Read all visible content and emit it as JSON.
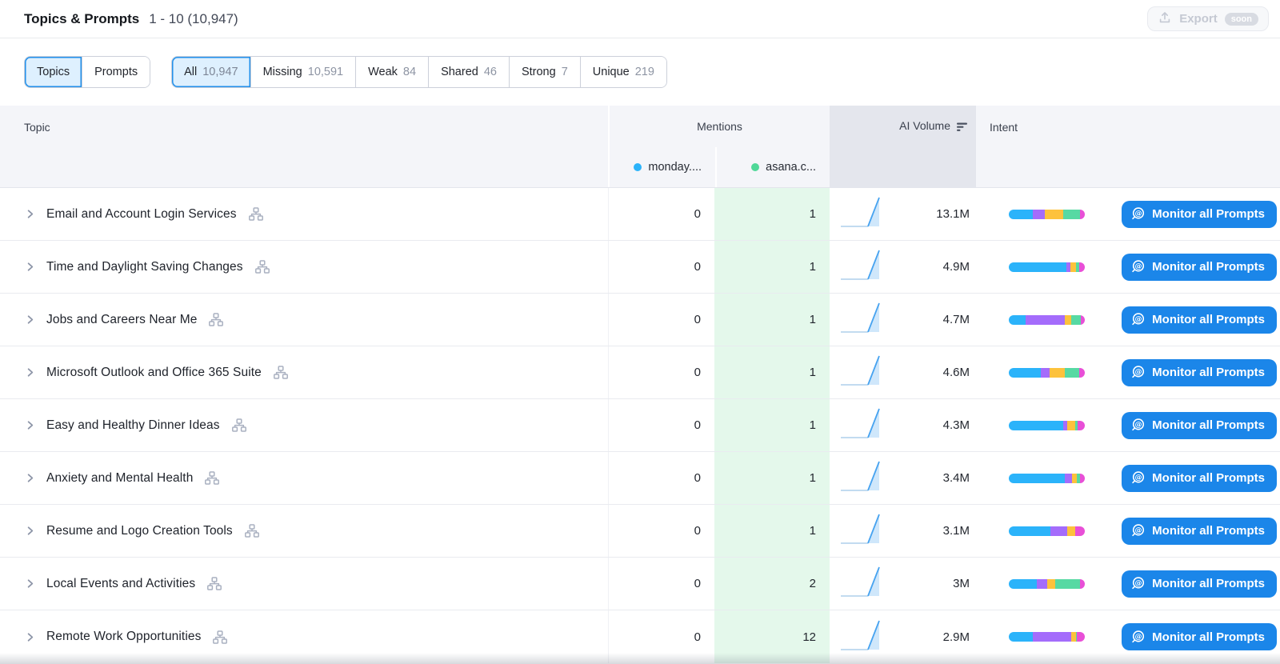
{
  "header": {
    "title": "Topics & Prompts",
    "range": "1 - 10 (10,947)",
    "export_label": "Export",
    "export_badge": "soon"
  },
  "view_toggle": [
    {
      "label": "Topics",
      "selected": true
    },
    {
      "label": "Prompts",
      "selected": false
    }
  ],
  "filter_tabs": [
    {
      "label": "All",
      "count": "10,947",
      "selected": true
    },
    {
      "label": "Missing",
      "count": "10,591",
      "selected": false
    },
    {
      "label": "Weak",
      "count": "84",
      "selected": false
    },
    {
      "label": "Shared",
      "count": "46",
      "selected": false
    },
    {
      "label": "Strong",
      "count": "7",
      "selected": false
    },
    {
      "label": "Unique",
      "count": "219",
      "selected": false
    }
  ],
  "table": {
    "columns": {
      "topic": "Topic",
      "mentions": "Mentions",
      "volume": "AI Volume",
      "intent": "Intent"
    },
    "competitors": [
      {
        "name": "monday....",
        "color": "#2bb3fa"
      },
      {
        "name": "asana.c...",
        "color": "#4fd898"
      }
    ],
    "button_label": "Monitor all Prompts",
    "intent_colors": [
      "#2bb3fa",
      "#a46cfb",
      "#fdc23c",
      "#57d9a3",
      "#e84fd7"
    ],
    "rows": [
      {
        "topic": "Email and Account Login Services",
        "mentions": [
          "0",
          "1"
        ],
        "ai_volume": "13.1M",
        "intent_segments": [
          32,
          15,
          25,
          22,
          6
        ]
      },
      {
        "topic": "Time and Daylight Saving Changes",
        "mentions": [
          "0",
          "1"
        ],
        "ai_volume": "4.9M",
        "intent_segments": [
          76,
          5,
          7,
          5,
          7
        ]
      },
      {
        "topic": "Jobs and Careers Near Me",
        "mentions": [
          "0",
          "1"
        ],
        "ai_volume": "4.7M",
        "intent_segments": [
          22,
          52,
          8,
          13,
          5
        ]
      },
      {
        "topic": "Microsoft Outlook and Office 365 Suite",
        "mentions": [
          "0",
          "1"
        ],
        "ai_volume": "4.6M",
        "intent_segments": [
          42,
          12,
          20,
          19,
          7
        ]
      },
      {
        "topic": "Easy and Healthy Dinner Ideas",
        "mentions": [
          "0",
          "1"
        ],
        "ai_volume": "4.3M",
        "intent_segments": [
          72,
          5,
          10,
          4,
          9
        ]
      },
      {
        "topic": "Anxiety and Mental Health",
        "mentions": [
          "0",
          "1"
        ],
        "ai_volume": "3.4M",
        "intent_segments": [
          74,
          9,
          7,
          4,
          6
        ]
      },
      {
        "topic": "Resume and Logo Creation Tools",
        "mentions": [
          "0",
          "1"
        ],
        "ai_volume": "3.1M",
        "intent_segments": [
          55,
          22,
          10,
          0,
          13
        ]
      },
      {
        "topic": "Local Events and Activities",
        "mentions": [
          "0",
          "2"
        ],
        "ai_volume": "3M",
        "intent_segments": [
          37,
          14,
          10,
          33,
          6
        ]
      },
      {
        "topic": "Remote Work Opportunities",
        "mentions": [
          "0",
          "12"
        ],
        "ai_volume": "2.9M",
        "intent_segments": [
          32,
          50,
          6,
          2,
          10
        ]
      }
    ]
  }
}
